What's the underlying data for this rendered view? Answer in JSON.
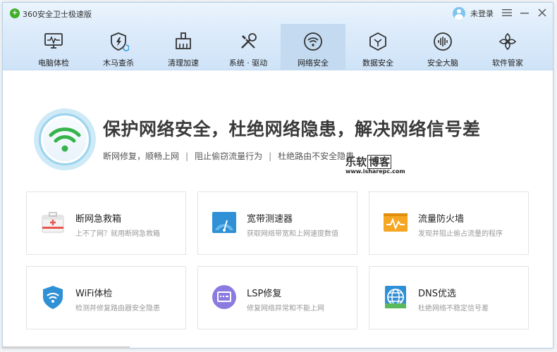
{
  "app": {
    "title": "360安全卫士极速版",
    "login_text": "未登录"
  },
  "window_controls": {
    "menu_icon": "menu-icon",
    "minimize_icon": "minimize-icon",
    "close_icon": "close-icon"
  },
  "nav": {
    "items": [
      {
        "label": "电脑体检",
        "icon": "monitor-icon",
        "active": false
      },
      {
        "label": "木马查杀",
        "icon": "shield-icon",
        "active": false
      },
      {
        "label": "清理加速",
        "icon": "broom-icon",
        "active": false
      },
      {
        "label": "系统 · 驱动",
        "icon": "tools-icon",
        "active": false
      },
      {
        "label": "网络安全",
        "icon": "wifi-icon",
        "active": true
      },
      {
        "label": "数据安全",
        "icon": "data-shield-icon",
        "active": false
      },
      {
        "label": "安全大脑",
        "icon": "brain-icon",
        "active": false
      },
      {
        "label": "软件管家",
        "icon": "apps-icon",
        "active": false
      }
    ]
  },
  "hero": {
    "title": "保护网络安全，杜绝网络隐患，解决网络信号差",
    "subtitle_parts": [
      "断网修复，顺畅上网",
      "阻止偷窃流量行为",
      "杜绝路由不安全隐患"
    ],
    "separator": "|"
  },
  "watermark": {
    "main": "乐软",
    "boxed": "博客",
    "url": "www.isharepc.com"
  },
  "tools": [
    {
      "title": "断网急救箱",
      "desc": "上不了网？就用断网急救箱",
      "icon": "first-aid-kit-icon"
    },
    {
      "title": "宽带测速器",
      "desc": "获取网络带宽和上网速度数值",
      "icon": "speedometer-icon"
    },
    {
      "title": "流量防火墙",
      "desc": "发现并阻止偷占流量的程序",
      "icon": "traffic-firewall-icon"
    },
    {
      "title": "WiFi体检",
      "desc": "检测并修复路由器安全隐患",
      "icon": "wifi-shield-icon"
    },
    {
      "title": "LSP修复",
      "desc": "修复网络异常和不能上网",
      "icon": "lsp-repair-icon"
    },
    {
      "title": "DNS优选",
      "desc": "杜绝网络不稳定信号差",
      "icon": "dns-globe-icon"
    }
  ],
  "colors": {
    "accent_green": "#3fae29",
    "nav_active_bg": "#c3daf1",
    "wifi_green": "#36b34a"
  }
}
